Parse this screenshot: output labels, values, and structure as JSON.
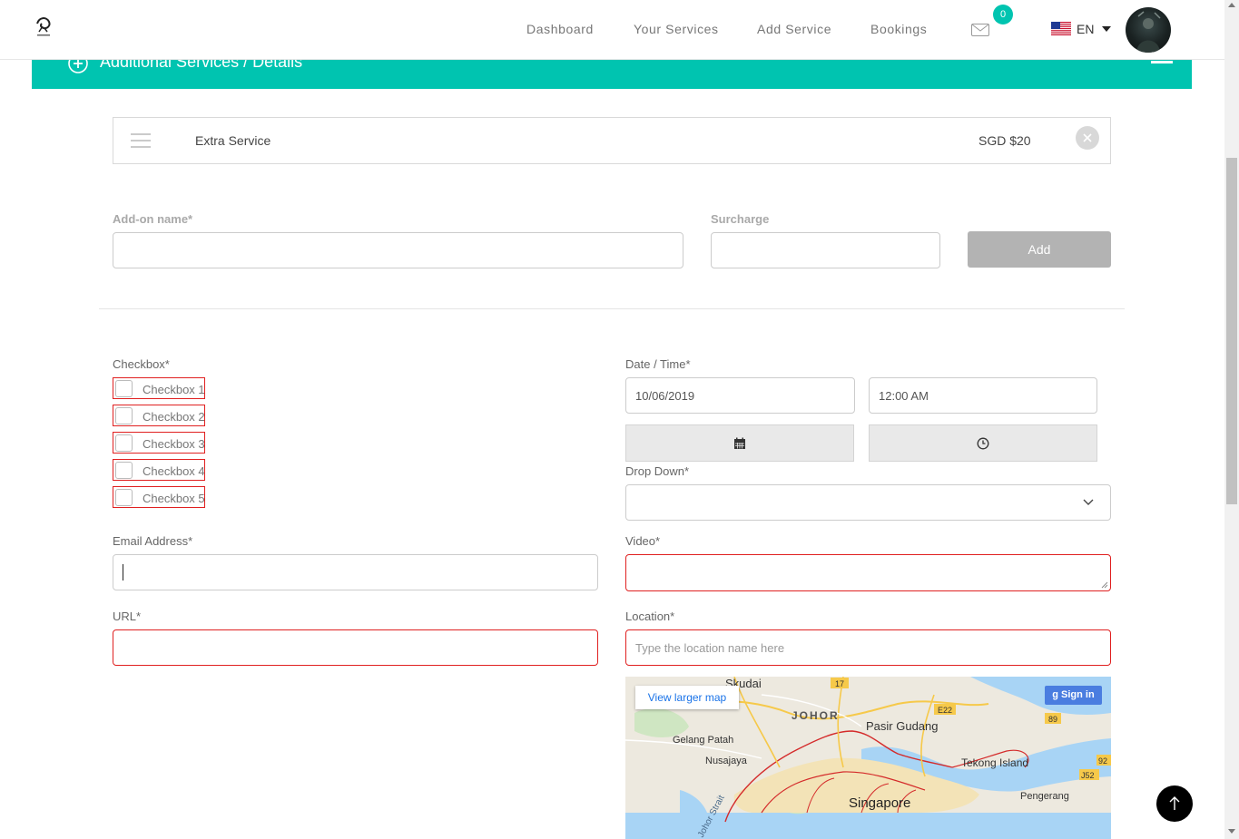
{
  "header": {
    "nav": [
      "Dashboard",
      "Your Services",
      "Add Service",
      "Bookings"
    ],
    "messages_count": "0",
    "language": "EN"
  },
  "section": {
    "title": "Additional Services / Details"
  },
  "extra_service": {
    "name": "Extra Service",
    "price": "SGD $20"
  },
  "addon_form": {
    "name_label": "Add-on name*",
    "surcharge_label": "Surcharge",
    "add_label": "Add"
  },
  "form": {
    "checkbox_label": "Checkbox*",
    "checkboxes": [
      "Checkbox 1",
      "Checkbox 2",
      "Checkbox 3",
      "Checkbox 4",
      "Checkbox 5"
    ],
    "datetime_label": "Date / Time*",
    "date_value": "10/06/2019",
    "time_value": "12:00 AM",
    "dropdown_label": "Drop Down*",
    "email_label": "Email Address*",
    "video_label": "Video*",
    "url_label": "URL*",
    "location_label": "Location*",
    "location_placeholder": "Type the location name here"
  },
  "map": {
    "view_larger": "View larger map",
    "sign_in": "Sign in",
    "places": [
      "Skudai",
      "JOHOR",
      "Pasir Gudang",
      "Gelang Patah",
      "Nusajaya",
      "Tekong Island",
      "Singapore",
      "Pengerang",
      "Johor Strait"
    ],
    "road_labels": [
      "17",
      "E22",
      "89",
      "92",
      "J52"
    ]
  },
  "colors": {
    "accent": "#00c4b0",
    "error": "#e02020",
    "button_disabled": "#b3b3b3"
  }
}
